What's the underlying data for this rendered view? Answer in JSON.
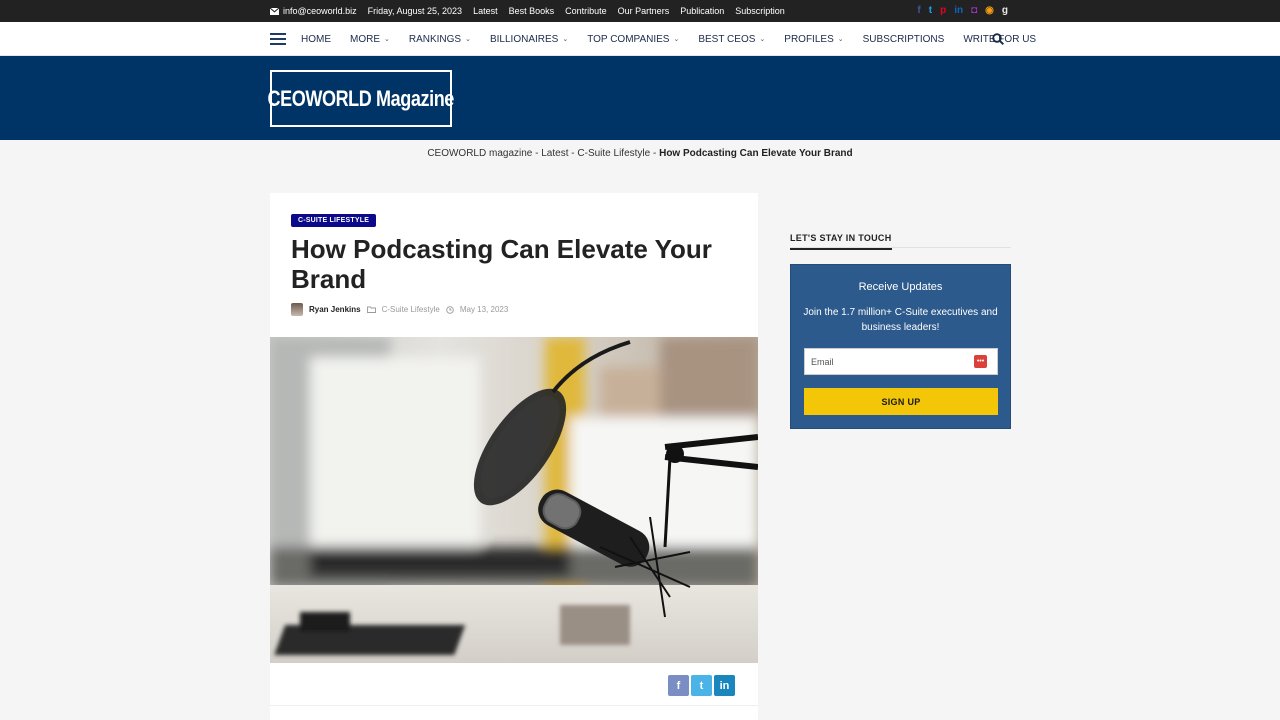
{
  "topbar": {
    "email": "info@ceoworld.biz",
    "date": "Friday, August 25, 2023",
    "links": [
      "Latest",
      "Best Books",
      "Contribute",
      "Our Partners",
      "Publication",
      "Subscription"
    ],
    "social": [
      {
        "name": "facebook-icon",
        "glyph": "f",
        "color": "#3b5998"
      },
      {
        "name": "twitter-icon",
        "glyph": "t",
        "color": "#1da1f2"
      },
      {
        "name": "pinterest-icon",
        "glyph": "p",
        "color": "#e60023"
      },
      {
        "name": "linkedin-icon",
        "glyph": "in",
        "color": "#0a66c2"
      },
      {
        "name": "instagram-icon",
        "glyph": "◘",
        "color": "#a334c8"
      },
      {
        "name": "rss-icon",
        "glyph": "◉",
        "color": "#f39c12"
      },
      {
        "name": "goodreads-icon",
        "glyph": "g",
        "color": "#e8e8e8"
      }
    ]
  },
  "nav": {
    "items": [
      {
        "label": "HOME",
        "dropdown": false
      },
      {
        "label": "MORE",
        "dropdown": true
      },
      {
        "label": "RANKINGS",
        "dropdown": true
      },
      {
        "label": "BILLIONAIRES",
        "dropdown": true
      },
      {
        "label": "TOP COMPANIES",
        "dropdown": true
      },
      {
        "label": "BEST CEOS",
        "dropdown": true
      },
      {
        "label": "PROFILES",
        "dropdown": true
      },
      {
        "label": "SUBSCRIPTIONS",
        "dropdown": false
      },
      {
        "label": "WRITE FOR US",
        "dropdown": false
      }
    ]
  },
  "logo": {
    "text": "CEOWORLD Magazine"
  },
  "breadcrumb": {
    "items": [
      "CEOWORLD magazine",
      "Latest",
      "C-Suite Lifestyle"
    ],
    "separator": " - ",
    "current": "How Podcasting Can Elevate Your Brand"
  },
  "article": {
    "category": "C-SUITE LIFESTYLE",
    "title": "How Podcasting Can Elevate Your Brand",
    "author": "Ryan Jenkins",
    "category_link": "C-Suite Lifestyle",
    "date": "May 13, 2023"
  },
  "share": [
    {
      "name": "share-facebook-button",
      "glyph": "f",
      "color": "#7a8ec4"
    },
    {
      "name": "share-twitter-button",
      "glyph": "t",
      "color": "#4ab3e8"
    },
    {
      "name": "share-linkedin-button",
      "glyph": "in",
      "color": "#1b86bd"
    }
  ],
  "sidebar": {
    "heading": "LET'S STAY IN TOUCH",
    "subscribe": {
      "title": "Receive Updates",
      "text": "Join the 1.7 million+ C-Suite executives and business leaders!",
      "email_placeholder": "Email",
      "button": "SIGN UP"
    }
  },
  "colors": {
    "topbar": "#222222",
    "band": "#003366",
    "category_badge": "#0a0a8a",
    "subscribe_bg": "#2d5a8c",
    "signup": "#f3c608"
  }
}
